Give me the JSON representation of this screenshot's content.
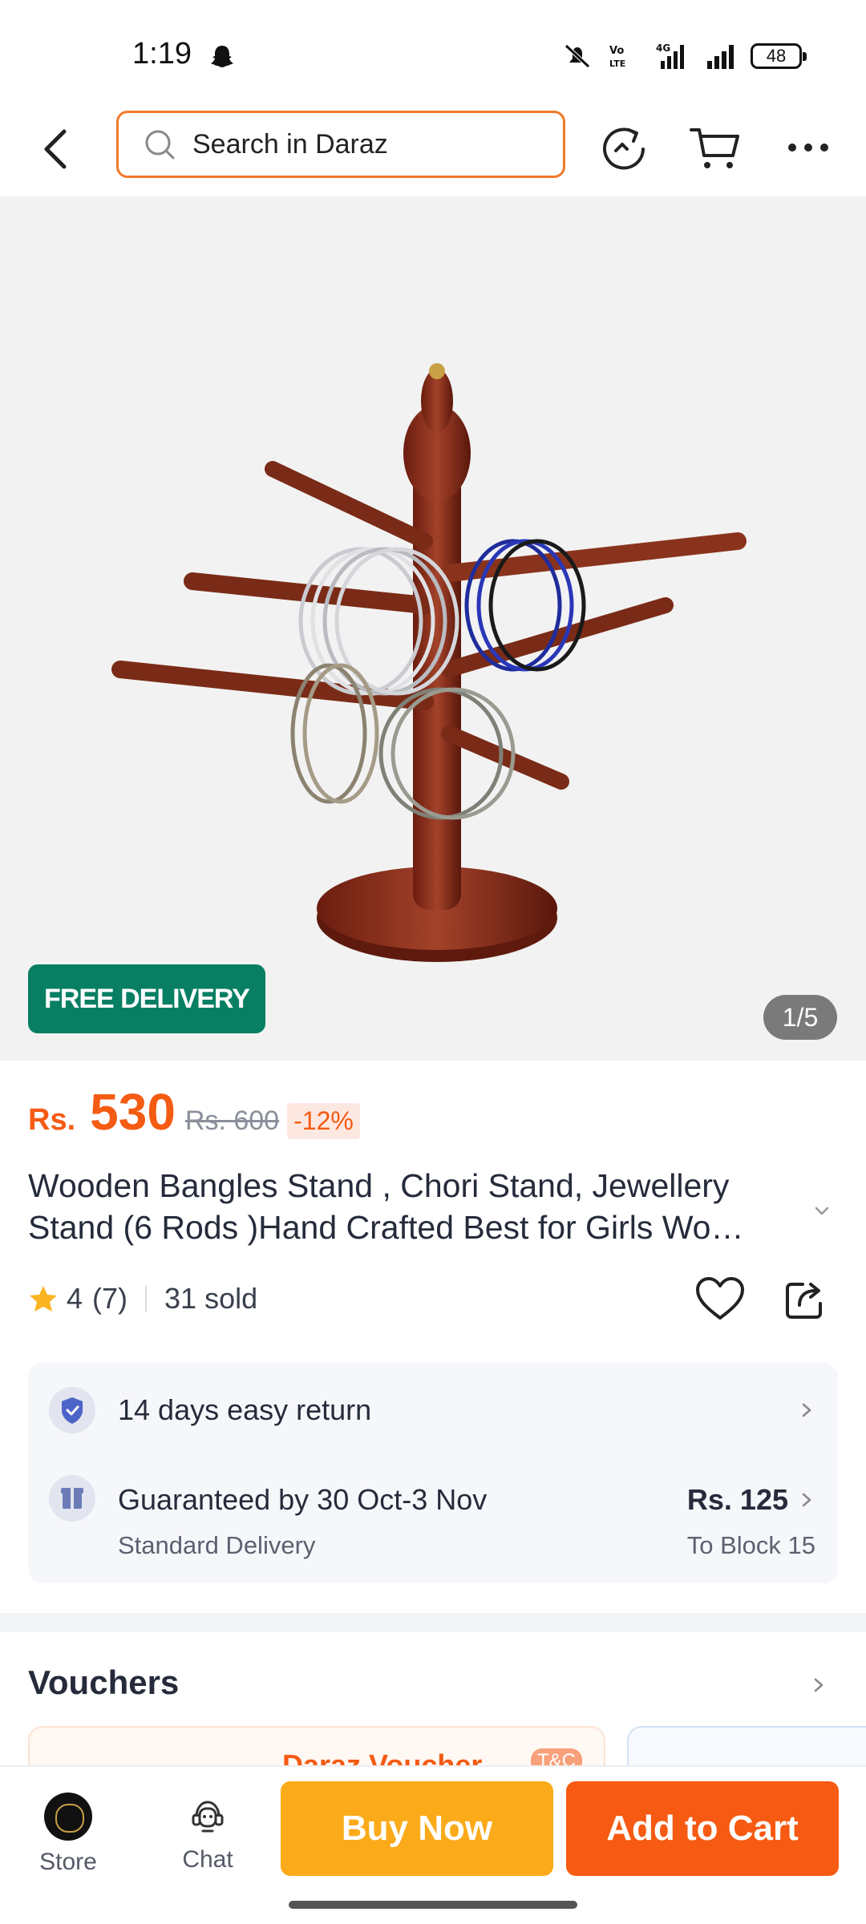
{
  "status_bar": {
    "time": "1:19",
    "battery": "48"
  },
  "search": {
    "placeholder": "Search in Daraz"
  },
  "hero": {
    "badge": "FREE DELIVERY",
    "page_counter": "1/5"
  },
  "product": {
    "currency": "Rs.",
    "price": "530",
    "old_price": "Rs. 600",
    "discount": "-12%",
    "title_line1": "Wooden Bangles Stand , Chori Stand, Jewellery",
    "title_line2": "Stand (6 Rods )Hand Crafted Best for Girls Wo…",
    "rating": "4",
    "review_count": "(7)",
    "sold": "31 sold"
  },
  "services": {
    "return_label": "14 days easy return",
    "delivery_label": "Guaranteed by 30 Oct-3 Nov",
    "delivery_sub": "Standard Delivery",
    "delivery_price": "Rs. 125",
    "delivery_location": "To Block 15"
  },
  "vouchers": {
    "title": "Vouchers",
    "card_name": "Daraz Voucher",
    "card_tc": "T&C"
  },
  "bottom_bar": {
    "store_label": "Store",
    "chat_label": "Chat",
    "buy_now": "Buy Now",
    "add_to_cart": "Add to Cart"
  },
  "colors": {
    "accent_orange": "#f45b13",
    "buy_now": "#fbaa19",
    "add_to_cart": "#f75a12",
    "free_delivery": "#087f63",
    "search_border": "#f2792a"
  }
}
